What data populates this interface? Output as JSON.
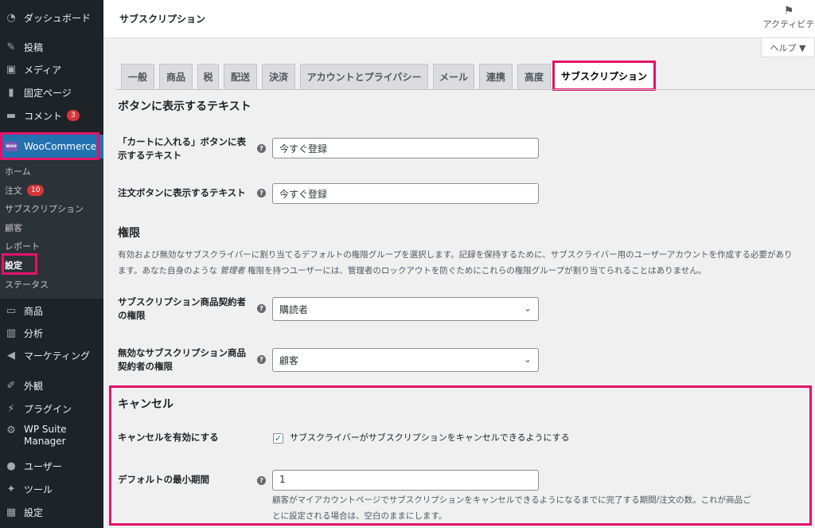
{
  "sidebar": {
    "dashboard": "ダッシュボード",
    "posts": "投稿",
    "media": "メディア",
    "pages": "固定ページ",
    "comments": "コメント",
    "comments_badge": "3",
    "woocommerce": "WooCommerce",
    "woo_logo_text": "woo",
    "woo_sub": {
      "home": "ホーム",
      "orders": "注文",
      "orders_badge": "10",
      "subscriptions": "サブスクリプション",
      "customers": "顧客",
      "reports": "レポート",
      "settings": "設定",
      "status": "ステータス"
    },
    "products": "商品",
    "analytics": "分析",
    "marketing": "マーケティング",
    "appearance": "外観",
    "plugins": "プラグイン",
    "wp_suite_line1": "WP Suite",
    "wp_suite_line2": "Manager",
    "users": "ユーザー",
    "tools": "ツール",
    "settings": "設定"
  },
  "topbar": {
    "title": "サブスクリプション",
    "activity": "アクティビテ",
    "help": "ヘルプ ▼"
  },
  "tabs": [
    "一般",
    "商品",
    "税",
    "配送",
    "決済",
    "アカウントとプライバシー",
    "メール",
    "連携",
    "高度",
    "サブスクリプション"
  ],
  "button_text": {
    "heading": "ボタンに表示するテキスト",
    "add_to_cart_label_1": "「カートに入れる」ボタンに表",
    "add_to_cart_label_2": "示するテキスト",
    "add_to_cart_value": "今すぐ登録",
    "order_button_label": "注文ボタンに表示するテキスト",
    "order_button_value": "今すぐ登録"
  },
  "roles": {
    "heading": "権限",
    "description_1": "有効および無効なサブスクライバーに割り当てるデフォルトの権限グループを選択します。記録を保持するために、サブスクライバー用のユーザーアカウントを作成する必要があり",
    "description_2a": "ます。あなた自身のような ",
    "description_2b": "管理者",
    "description_2c": " 権限を持つユーザーには、管理者のロックアウトを防ぐためにこれらの権限グループが割り当てられることはありません。",
    "active_label_1": "サブスクリプション商品契約者",
    "active_label_2": "の権限",
    "active_value": "購読者",
    "inactive_label_1": "無効なサブスクリプション商品",
    "inactive_label_2": "契約者の権限",
    "inactive_value": "顧客"
  },
  "cancel": {
    "heading": "キャンセル",
    "enable_label": "キャンセルを有効にする",
    "enable_checkbox_text": "サブスクライバーがサブスクリプションをキャンセルできるようにする",
    "enable_checked": true,
    "min_period_label": "デフォルトの最小期間",
    "min_period_value": "1",
    "min_period_desc_1": "顧客がマイアカウントページでサブスクリプションをキャンセルできるようになるまでに完了する期間/注文の数。これが商品ご",
    "min_period_desc_2": "とに設定される場合は、空白のままにします。"
  },
  "icons": {
    "help": "help-icon",
    "chevron": "chevron-down-icon",
    "check": "check-icon",
    "flag": "flag-icon"
  },
  "colors": {
    "highlight": "#e4136a",
    "admin_blue": "#2271b1",
    "sidebar_bg": "#1d2327",
    "badge_red": "#d63638"
  }
}
